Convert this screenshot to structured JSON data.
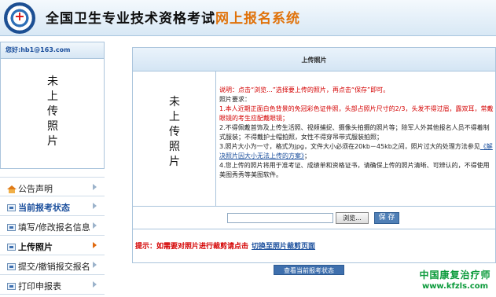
{
  "header": {
    "title_main": "全国卫生专业技术资格考试",
    "title_accent": "网上报名系统"
  },
  "sidebar": {
    "greeting": "您好:hb1@163.com",
    "photo_placeholder": "未上传照片",
    "items": [
      {
        "label": "公告声明",
        "icon": "house-icon"
      },
      {
        "label": "当前报考状态",
        "icon": "status-icon"
      },
      {
        "label": "填写/修改报名信息",
        "icon": "form-icon"
      },
      {
        "label": "上传照片",
        "icon": "photo-icon"
      },
      {
        "label": "提交/撤销报交报名",
        "icon": "submit-icon"
      },
      {
        "label": "打印申报表",
        "icon": "print-icon"
      }
    ]
  },
  "main": {
    "section_title": "上传照片",
    "photo_placeholder": "未上传照片",
    "instructions": {
      "intro": "说明：点击“浏览...”选择要上传的照片，再点击“保存”即可。",
      "requirements_heading": "照片要求：",
      "req1": "1.本人近期正面白色背景的免冠彩色证件照，头部占照片尺寸的2/3，头发不得过眉，露双耳，常戴眼镜的考生应配戴眼镜；",
      "req2": "2.不得佩戴首饰及上传生活照、视频捕捉、摄像头拍摄的照片等；除军人外其他报名人员不得着制式服装；不得戴护士帽拍照，女性不得穿吊带式服装拍照；",
      "req3_text": "3.照片大小为一寸，格式为jpg，文件大小必须在20kb－45kb之间，照片过大的处理方法参见",
      "req3_link": "《解决照片因大小无法上传的方案》",
      "req3_end": "；",
      "req4": "4.您上传的照片将用于准考证、成绩单和资格证书，请确保上传的照片清晰、可辨认的，不得使用美图秀秀等美图软件。"
    },
    "file_input_value": "",
    "browse_label": "浏览...",
    "save_label": "保 存",
    "tip_label": "提示：如需要对照片进行裁剪请点击",
    "tip_link": "切换至照片裁剪页面",
    "status_button": "查看当前报考状态"
  },
  "watermark": {
    "line1": "中国康复治疗师",
    "line2": "www.kfzls.com"
  },
  "colors": {
    "accent_orange": "#e0720a",
    "link_blue": "#1a4e9c",
    "warning_red": "#d40000",
    "watermark_green": "#0a9a3a"
  }
}
